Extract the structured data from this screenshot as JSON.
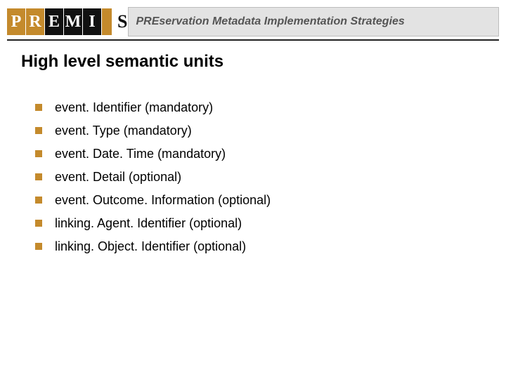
{
  "header": {
    "logo": {
      "letters": [
        {
          "char": "P",
          "bg": "#c48a2c"
        },
        {
          "char": "R",
          "bg": "#c48a2c"
        },
        {
          "char": "E",
          "bg": "#111111"
        },
        {
          "char": "M",
          "bg": "#111111"
        },
        {
          "char": "I",
          "bg": "#111111"
        }
      ],
      "bar_color": "#c48a2c",
      "last_letter": {
        "char": "S",
        "color": "#111111"
      }
    },
    "tagline": {
      "strong": "PRE",
      "rest1": "servation ",
      "strong2": "M",
      "rest2": "etadata ",
      "strong3": "I",
      "rest3": "mplementation ",
      "strong4": "S",
      "rest4": "trategies"
    }
  },
  "title": "High level semantic units",
  "items": [
    "event. Identifier (mandatory)",
    "event. Type (mandatory)",
    "event. Date. Time (mandatory)",
    "event. Detail (optional)",
    "event. Outcome. Information (optional)",
    "linking. Agent. Identifier  (optional)",
    "linking. Object. Identifier (optional)"
  ],
  "colors": {
    "bullet": "#c48a2c"
  }
}
